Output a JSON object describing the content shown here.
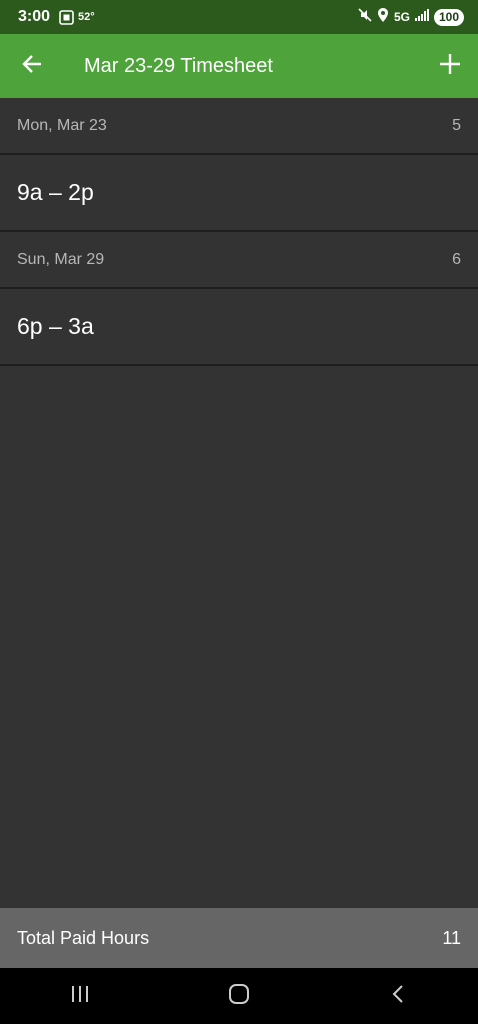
{
  "status_bar": {
    "time": "3:00",
    "temperature": "52°",
    "network": "5G",
    "battery": "100"
  },
  "app_bar": {
    "title": "Mar 23-29 Timesheet",
    "back_icon": "arrow-left-icon",
    "add_icon": "plus-icon"
  },
  "days": [
    {
      "label": "Mon, Mar 23",
      "hours": "5",
      "shifts": [
        "9a – 2p"
      ]
    },
    {
      "label": "Sun, Mar 29",
      "hours": "6",
      "shifts": [
        "6p – 3a"
      ]
    }
  ],
  "footer": {
    "label": "Total Paid Hours",
    "value": "11"
  },
  "colors": {
    "status_bar": "#2c5a1d",
    "app_bar": "#4ea33a",
    "background": "#333333",
    "footer": "#666666"
  }
}
